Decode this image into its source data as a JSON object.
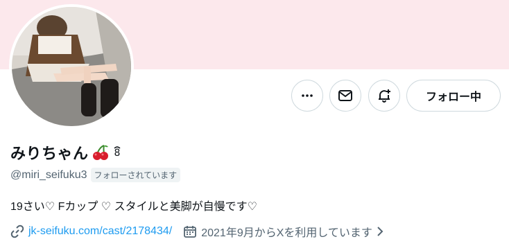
{
  "profile": {
    "display_name": "みりちゃん",
    "name_emoji": "cherry",
    "name_badge": "8",
    "handle": "@miri_seifuku3",
    "follows_you": "フォローされています",
    "bio": "19さい♡ Fカップ ♡ スタイルと美脚が自慢です♡",
    "website": "jk-seifuku.com/cast/2178434/",
    "joined": "2021年9月からXを利用しています"
  },
  "actions": {
    "following_label": "フォロー中",
    "more_icon": "more-icon",
    "message_icon": "mail-icon",
    "notify_icon": "bell-plus-icon"
  },
  "colors": {
    "banner": "#fce8ec",
    "link": "#1d9bf0",
    "secondary_text": "#536471",
    "border": "#cfd9de"
  }
}
